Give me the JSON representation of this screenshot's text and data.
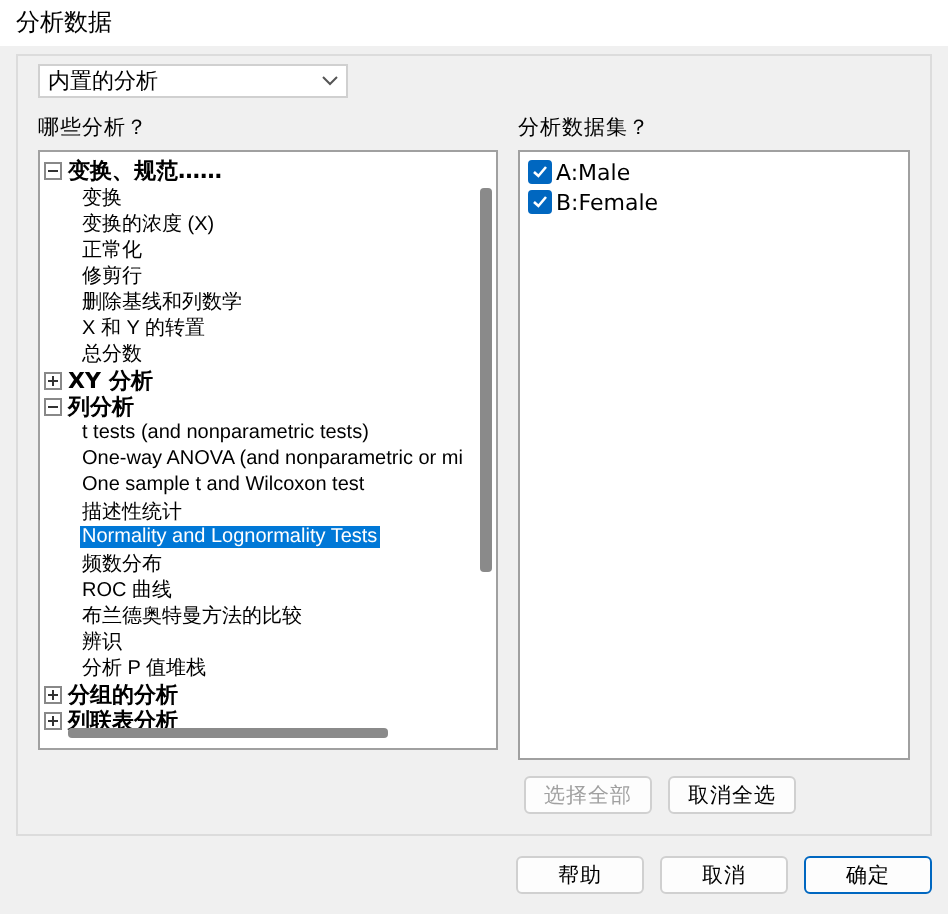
{
  "window": {
    "title": "分析数据"
  },
  "analysis_type": {
    "value": "内置的分析"
  },
  "analyses": {
    "label": "哪些分析？",
    "groups": [
      {
        "label": "变换、规范……",
        "expanded": true,
        "children": [
          {
            "label": "变换",
            "selected": false
          },
          {
            "label": "变换的浓度 (X)",
            "selected": false
          },
          {
            "label": "正常化",
            "selected": false
          },
          {
            "label": "修剪行",
            "selected": false
          },
          {
            "label": "删除基线和列数学",
            "selected": false
          },
          {
            "label": "X 和 Y 的转置",
            "selected": false
          },
          {
            "label": "总分数",
            "selected": false
          }
        ]
      },
      {
        "label": "XY 分析",
        "expanded": false
      },
      {
        "label": "列分析",
        "expanded": true,
        "children": [
          {
            "label": "t tests (and nonparametric tests)",
            "selected": false
          },
          {
            "label": "One-way ANOVA (and nonparametric or mi",
            "selected": false
          },
          {
            "label": "One sample t and Wilcoxon test",
            "selected": false
          },
          {
            "label": "描述性统计",
            "selected": false
          },
          {
            "label": "Normality and Lognormality Tests",
            "selected": true
          },
          {
            "label": "频数分布",
            "selected": false
          },
          {
            "label": "ROC 曲线",
            "selected": false
          },
          {
            "label": "布兰德奥特曼方法的比较",
            "selected": false
          },
          {
            "label": "辨识",
            "selected": false
          },
          {
            "label": "分析 P 值堆栈",
            "selected": false
          }
        ]
      },
      {
        "label": "分组的分析",
        "expanded": false
      },
      {
        "label": "列联表分析",
        "expanded": false
      }
    ]
  },
  "datasets": {
    "label": "分析数据集？",
    "items": [
      {
        "label": "A:Male",
        "checked": true
      },
      {
        "label": "B:Female",
        "checked": true
      }
    ]
  },
  "list_buttons": [
    {
      "label": "选择全部",
      "disabled": true
    },
    {
      "label": "取消全选",
      "disabled": false
    }
  ],
  "buttons": [
    {
      "label": "帮助",
      "default": false
    },
    {
      "label": "取消",
      "default": false
    },
    {
      "label": "确定",
      "default": true
    }
  ]
}
